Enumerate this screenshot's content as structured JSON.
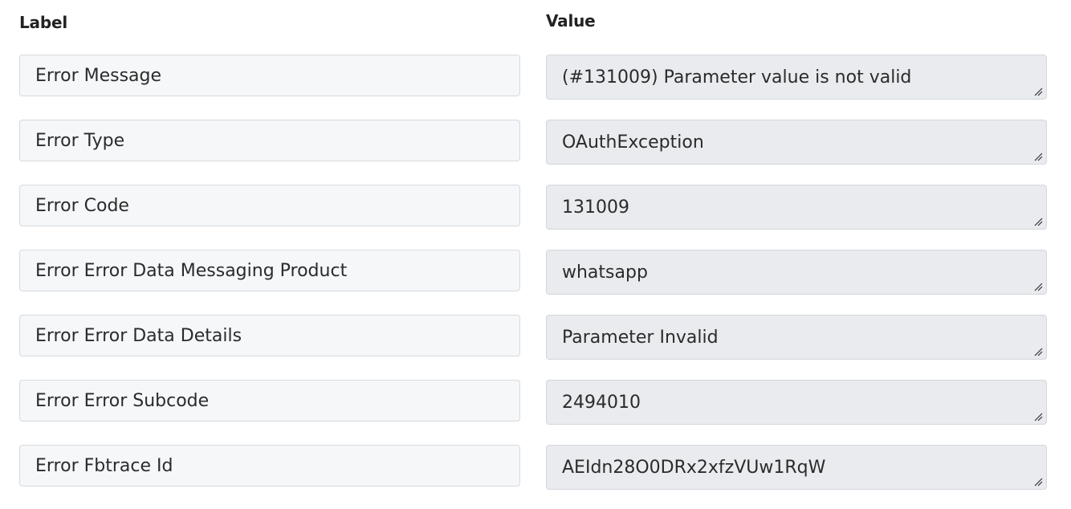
{
  "headers": {
    "label": "Label",
    "value": "Value"
  },
  "rows": [
    {
      "label": "Error Message",
      "value": "(#131009) Parameter value is not valid"
    },
    {
      "label": "Error Type",
      "value": "OAuthException"
    },
    {
      "label": "Error Code",
      "value": "131009"
    },
    {
      "label": "Error Error Data Messaging Product",
      "value": "whatsapp"
    },
    {
      "label": "Error Error Data Details",
      "value": "Parameter Invalid"
    },
    {
      "label": "Error Error Subcode",
      "value": "2494010"
    },
    {
      "label": "Error Fbtrace Id",
      "value": "AEIdn28O0DRx2xfzVUw1RqW"
    }
  ],
  "icons": {
    "resize": "resize-handle-icon"
  }
}
